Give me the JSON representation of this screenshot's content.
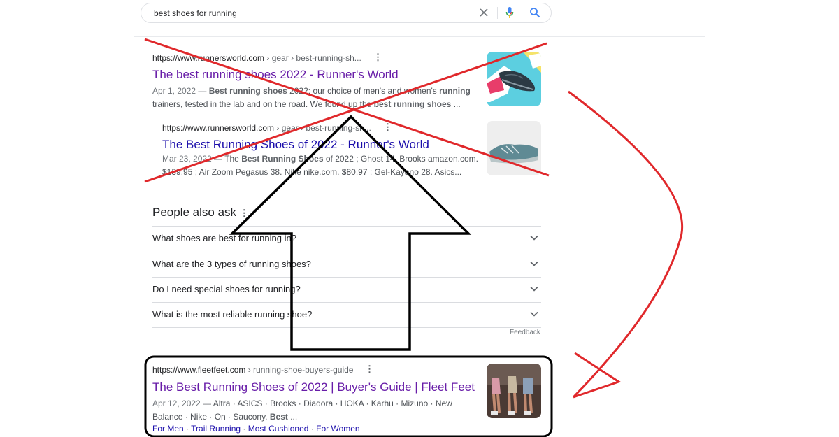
{
  "search": {
    "query": "best shoes for running"
  },
  "results": [
    {
      "url": "https://www.runnersworld.com",
      "breadcrumb": " › gear › best-running-sh...",
      "more": "⋮",
      "title": "The best running shoes 2022 - Runner's World",
      "date": "Apr 1, 2022 —",
      "snippet_line1_a": "Best running shoes",
      "snippet_line1_b": " 2022: our choice of men's and women's ",
      "snippet_line1_c": "running",
      "snippet_line2_a": "trainers, tested in the lab and on the road. We found up the ",
      "snippet_line2_b": "best running shoes",
      "snippet_line2_c": " ..."
    },
    {
      "url": "https://www.runnersworld.com",
      "breadcrumb": " › gear › best-running-sh...",
      "more": "⋮",
      "title": "The Best Running Shoes of 2022 - Runner's World",
      "date": "Mar 23, 2022 —",
      "snippet_line1_a": " The ",
      "snippet_line1_b": "Best Running Shoes",
      "snippet_line1_c": " of 2022 ; Ghost 14. Brooks amazon.com.",
      "snippet_line2": "$139.95 ; Air Zoom Pegasus 38. Nike nike.com. $80.97 ; Gel-Kayano 28. Asics..."
    },
    {
      "url": "https://www.fleetfeet.com",
      "breadcrumb": " › running-shoe-buyers-guide",
      "more": "⋮",
      "title": "The Best Running Shoes of 2022 | Buyer's Guide | Fleet Feet",
      "date": "Apr 12, 2022 —",
      "snippet_line1": " Altra · ASICS · Brooks · Diadora · HOKA · Karhu · Mizuno · New",
      "snippet_line2_a": "Balance · Nike · On · Saucony. ",
      "snippet_line2_b": "Best",
      "snippet_line2_c": " ...",
      "sitelinks": [
        "For Men",
        "Trail Running",
        "Most Cushioned",
        "For Women"
      ],
      "sitelink_sep": " · "
    }
  ],
  "people_also_ask": {
    "title": "People also ask",
    "more": "⋮",
    "questions": [
      "What shoes are best for running in?",
      "What are the 3 types of running shoes?",
      "Do I need special shoes for running?",
      "What is the most reliable running shoe?"
    ],
    "feedback": "Feedback"
  },
  "colors": {
    "visited_link": "#681da8",
    "link": "#1a0dab",
    "annotation_red": "#e0282b",
    "annotation_black": "#000000"
  }
}
